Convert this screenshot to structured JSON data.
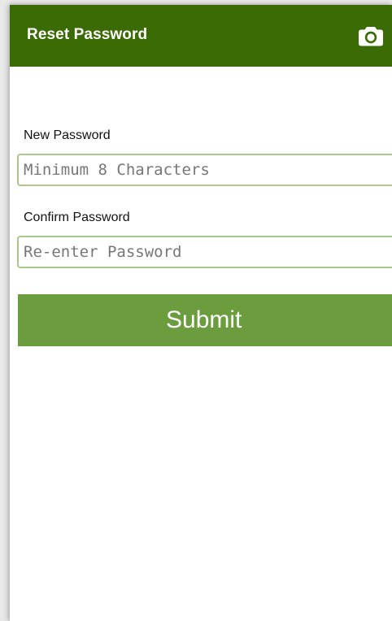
{
  "colors": {
    "app_bar": "#3b6b04",
    "accent": "#6b9d3f",
    "input_border": "#a7c98a"
  },
  "header": {
    "title": "Reset Password",
    "action_icon": "camera-icon"
  },
  "form": {
    "new_password": {
      "label": "New Password",
      "placeholder": "Minimum 8 Characters",
      "value": ""
    },
    "confirm_password": {
      "label": "Confirm Password",
      "placeholder": "Re-enter Password",
      "value": ""
    },
    "submit_label": "Submit"
  }
}
